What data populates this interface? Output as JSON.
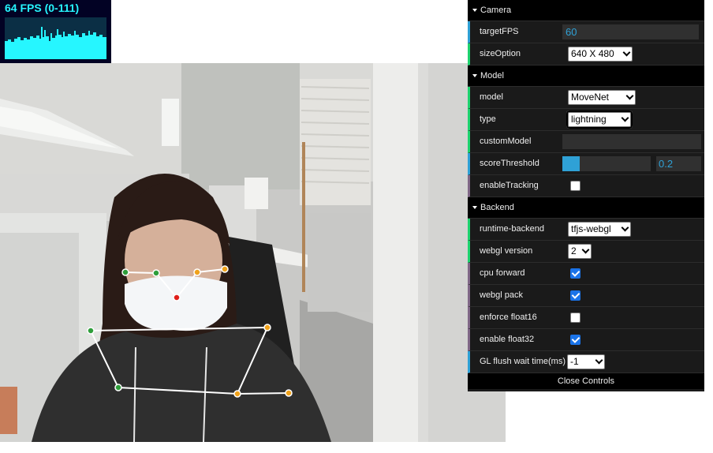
{
  "stats": {
    "fps_text": "64 FPS (0-111)"
  },
  "gui": {
    "camera": {
      "title": "Camera",
      "target_fps_label": "targetFPS",
      "target_fps_value": "60",
      "size_option_label": "sizeOption",
      "size_option_value": "640 X 480"
    },
    "model": {
      "title": "Model",
      "model_label": "model",
      "model_value": "MoveNet",
      "type_label": "type",
      "type_value": "lightning",
      "custom_model_label": "customModel",
      "custom_model_value": "",
      "score_threshold_label": "scoreThreshold",
      "score_threshold_value": "0.2",
      "score_threshold_fraction": 0.2,
      "enable_tracking_label": "enableTracking",
      "enable_tracking_checked": false
    },
    "backend": {
      "title": "Backend",
      "runtime_label": "runtime-backend",
      "runtime_value": "tfjs-webgl",
      "webgl_version_label": "webgl version",
      "webgl_version_value": "2",
      "cpu_forward_label": "cpu forward",
      "cpu_forward_checked": true,
      "webgl_pack_label": "webgl pack",
      "webgl_pack_checked": true,
      "enforce_float16_label": "enforce float16",
      "enforce_float16_checked": false,
      "enable_float32_label": "enable float32",
      "enable_float32_checked": true,
      "gl_flush_label": "GL flush wait time(ms)",
      "gl_flush_value": "-1"
    },
    "close_label": "Close Controls"
  },
  "colors": {
    "fps_cyan": "#26f6ff",
    "number_accent": "#2fa1d6",
    "option_accent": "#1ed36f",
    "bool_accent": "#806787",
    "keypoint_left": "#2e9e3a",
    "keypoint_right": "#f0a21b",
    "keypoint_nose": "#e0201b"
  }
}
